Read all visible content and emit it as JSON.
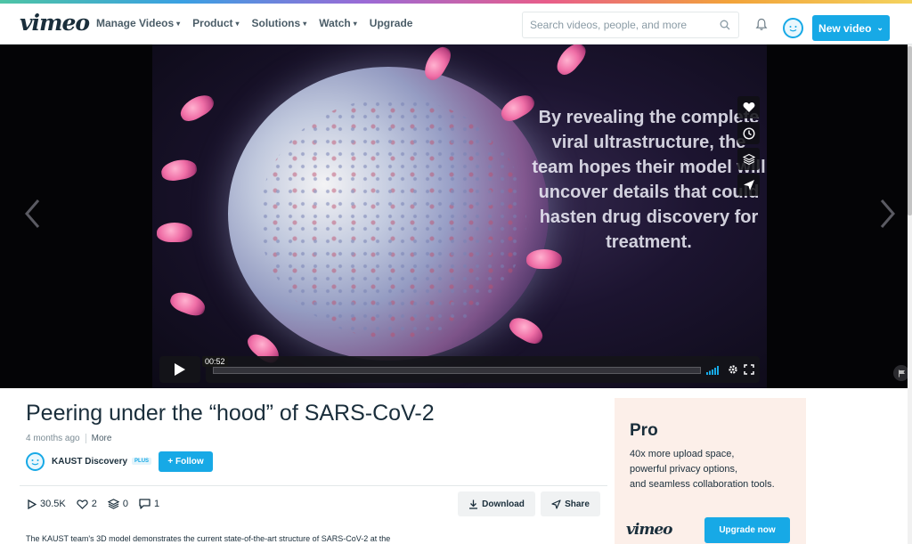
{
  "header": {
    "logo": "vimeo",
    "nav": [
      {
        "label": "Manage Videos",
        "has_menu": true
      },
      {
        "label": "Product",
        "has_menu": true
      },
      {
        "label": "Solutions",
        "has_menu": true
      },
      {
        "label": "Watch",
        "has_menu": true
      },
      {
        "label": "Upgrade",
        "has_menu": false
      }
    ],
    "search_placeholder": "Search videos, people, and more",
    "new_video_label": "New video"
  },
  "player": {
    "overlay_text": "By revealing the complete viral ultrastructure, the team hopes their model will uncover details that could hasten drug discovery for treatment.",
    "time": "00:52",
    "side_actions": [
      "heart-icon",
      "clock-icon",
      "layers-icon",
      "send-icon"
    ]
  },
  "video": {
    "title": "Peering under the “hood” of SARS-CoV-2",
    "age": "4 months ago",
    "more_label": "More",
    "channel": "KAUST Discovery",
    "plus_badge": "PLUS",
    "follow_label": "+ Follow",
    "stats": {
      "plays": "30.5K",
      "likes": "2",
      "collections": "0",
      "comments": "1"
    },
    "download_label": "Download",
    "share_label": "Share",
    "description": "The KAUST team's 3D model demonstrates the current state-of-the-art structure of SARS-CoV-2 at the"
  },
  "pro_ad": {
    "title": "Pro",
    "lines": [
      "40x more upload space,",
      "powerful privacy options,",
      "and seamless collaboration tools."
    ],
    "logo": "vimeo",
    "upgrade_label": "Upgrade now"
  },
  "colors": {
    "accent": "#17a9e6",
    "text": "#1a2e3b",
    "ad_bg": "#fcefe9"
  }
}
